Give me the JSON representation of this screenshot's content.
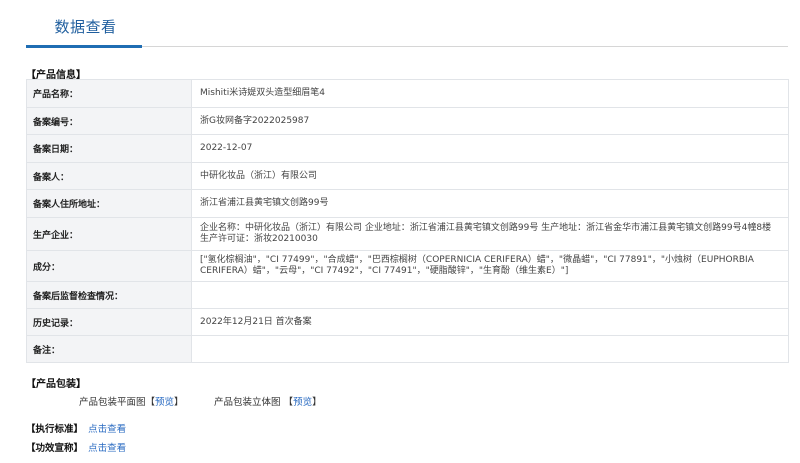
{
  "tab": {
    "title": "数据查看"
  },
  "product_info": {
    "section_title": "【产品信息】",
    "rows": [
      {
        "label": "产品名称：",
        "value": "Mishiti米诗媞双头造型细眉笔4"
      },
      {
        "label": "备案编号：",
        "value": "浙G妆网备字2022025987"
      },
      {
        "label": "备案日期：",
        "value": "2022-12-07"
      },
      {
        "label": "备案人：",
        "value": "中研化妆品（浙江）有限公司"
      },
      {
        "label": "备案人住所地址：",
        "value": "浙江省浦江县黄宅镇文创路99号"
      },
      {
        "label": "生产企业：",
        "value": "企业名称：中研化妆品（浙江）有限公司 企业地址：浙江省浦江县黄宅镇文创路99号 生产地址：浙江省金华市浦江县黄宅镇文创路99号4幢8楼 生产许可证：浙妆20210030"
      },
      {
        "label": "成分：",
        "value": "[\"氢化棕榈油\"，\"CI 77499\"，\"合成蜡\"，\"巴西棕榈树（COPERNICIA CERIFERA）蜡\"，\"微晶蜡\"，\"CI 77891\"，\"小烛树（EUPHORBIA CERIFERA）蜡\"，\"云母\"，\"CI 77492\"，\"CI 77491\"，\"硬脂酸锌\"，\"生育酚（维生素E）\"]"
      },
      {
        "label": "备案后监督检查情况：",
        "value": ""
      },
      {
        "label": "历史记录：",
        "value": "2022年12月21日 首次备案"
      },
      {
        "label": "备注：",
        "value": ""
      }
    ]
  },
  "packaging": {
    "section_title": "【产品包装】",
    "flat_label": "产品包装平面图",
    "stereo_label": "产品包装立体图",
    "preview_open": "【",
    "preview_text": "预览",
    "preview_close": "】"
  },
  "standard": {
    "section_title": "【执行标准】",
    "link": "点击查看"
  },
  "efficacy": {
    "section_title": "【功效宣称】",
    "link": "点击查看"
  }
}
